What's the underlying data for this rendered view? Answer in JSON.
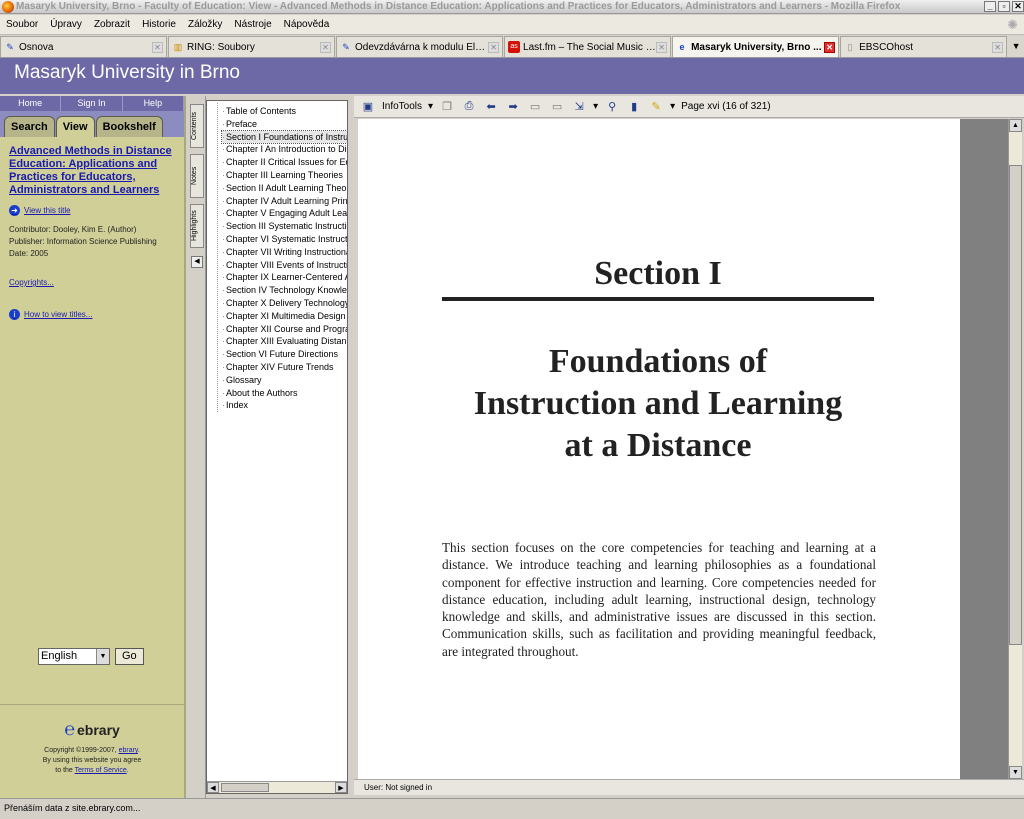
{
  "window": {
    "title": "Masaryk University, Brno - Faculty of Education: View - Advanced Methods in Distance Education: Applications and Practices for Educators, Administrators and Learners - Mozilla Firefox"
  },
  "menu": [
    "Soubor",
    "Úpravy",
    "Zobrazit",
    "Historie",
    "Záložky",
    "Nástroje",
    "Nápověda"
  ],
  "tabs": [
    {
      "label": "Osnova",
      "icon": "page-icon"
    },
    {
      "label": "RING: Soubory",
      "icon": "folder-icon"
    },
    {
      "label": "Odevzdávárna k modulu Elekt...",
      "icon": "page-icon"
    },
    {
      "label": "Last.fm – The Social Music Re...",
      "icon": "lastfm-icon"
    },
    {
      "label": "Masaryk University, Brno ...",
      "icon": "ebrary-icon"
    },
    {
      "label": "EBSCOhost",
      "icon": "blank-page-icon"
    }
  ],
  "banner": {
    "title": "Masaryk University in Brno"
  },
  "sidebar": {
    "nav": [
      "Home",
      "Sign In",
      "Help"
    ],
    "tabs": [
      "Search",
      "View",
      "Bookshelf"
    ],
    "book_title": "Advanced Methods in Distance Education: Applications and Practices for Educators, Administrators and Learners",
    "view_this_title": "View this title",
    "contributor": "Contributor: Dooley, Kim E. (Author)",
    "publisher": "Publisher: Information Science Publishing",
    "date": "Date: 2005",
    "copyrights": "Copyrights...",
    "how_to": "How to view titles...",
    "language": "English",
    "go": "Go",
    "logo": "ebrary",
    "copyright_line1": "Copyright ©1999-2007,",
    "copyright_link": "ebrary",
    "copyright_line2": "By using this website you agree",
    "copyright_line3": "to the",
    "terms_link": "Terms of Service"
  },
  "vtabs": [
    "Contents",
    "Notes",
    "Highlights"
  ],
  "toc": [
    "Table of Contents",
    "Preface",
    "Section I Foundations of Instruction and Learning at a Distance",
    "Chapter I An Introduction to Distance Education",
    "Chapter II Critical Issues for Educators",
    "Chapter III Learning Theories",
    "Section II Adult Learning Theory",
    "Chapter IV Adult Learning Principles",
    "Chapter V Engaging Adult Learners",
    "Section III Systematic Instructional Design",
    "Chapter VI Systematic Instructional Design",
    "Chapter VII Writing Instructional Objectives",
    "Chapter VIII Events of Instruction",
    "Chapter IX Learner-Centered Assessment",
    "Section IV Technology Knowledge and Skills",
    "Chapter X Delivery Technology",
    "Chapter XI Multimedia Design",
    "Chapter XII Course and Program Management",
    "Chapter XIII Evaluating Distance Education",
    "Section VI Future Directions",
    "Chapter XIV Future Trends",
    "Glossary",
    "About the Authors",
    "Index"
  ],
  "toc_selected": 2,
  "toolbar": {
    "infotools": "InfoTools",
    "page": "Page xvi (16 of 321)"
  },
  "page": {
    "heading": "Section I",
    "title_lines": [
      "Foundations of",
      "Instruction and Learning",
      "at a Distance"
    ],
    "body": "This section focuses on the core competencies for teaching and learning at a distance. We introduce teaching and learning philosophies as a foundational component for effective instruction and learning. Core competencies needed for distance education, including adult learning, instructional design, technology knowledge and skills, and administrative issues are discussed in this section. Communication skills, such as facilitation and providing meaningful feedback, are integrated throughout."
  },
  "user_status": "User: Not signed in",
  "status": "Přenáším data z site.ebrary.com..."
}
